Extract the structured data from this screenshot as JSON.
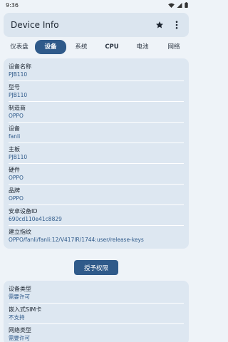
{
  "status": {
    "time": "9:36"
  },
  "app": {
    "title": "Device Info"
  },
  "tabs": [
    "仪表盘",
    "设备",
    "系统",
    "CPU",
    "电池",
    "网络"
  ],
  "device_card": [
    {
      "label": "设备名称",
      "value": "PJB110"
    },
    {
      "label": "型号",
      "value": "PJB110"
    },
    {
      "label": "制造商",
      "value": "OPPO"
    },
    {
      "label": "设备",
      "value": "fanli"
    },
    {
      "label": "主板",
      "value": "PJB110"
    },
    {
      "label": "硬件",
      "value": "OPPO"
    },
    {
      "label": "品牌",
      "value": "OPPO"
    },
    {
      "label": "安卓设备ID",
      "value": "690cd110e41c8829"
    },
    {
      "label": "建立指纹",
      "value": "OPPO/fanli/fanli:12/V417IR/1744:user/release-keys"
    }
  ],
  "grant_button": "授予权限",
  "permission_card": [
    {
      "label": "设备类型",
      "value": "需要许可"
    },
    {
      "label": "嵌入式SIM卡",
      "value": "不支持"
    },
    {
      "label": "网络类型",
      "value": "需要许可"
    }
  ],
  "colors": {
    "accent": "#2f5a8a",
    "card": "#dde7f1",
    "background": "#eef3f8"
  }
}
